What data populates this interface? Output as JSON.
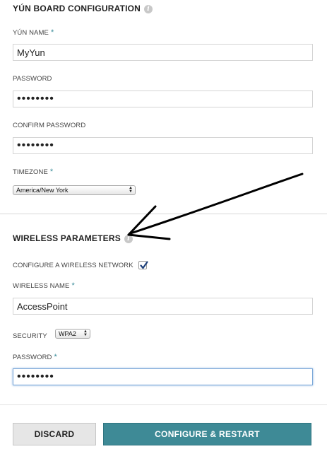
{
  "board_section": {
    "title": "YÚN BOARD CONFIGURATION",
    "info_glyph": "i",
    "name_label": "YÚN NAME",
    "name_value": "MyYun",
    "password_label": "PASSWORD",
    "password_value": "••••••••",
    "confirm_label": "CONFIRM PASSWORD",
    "confirm_value": "••••••••",
    "timezone_label": "TIMEZONE",
    "timezone_value": "America/New York"
  },
  "wireless_section": {
    "title": "WIRELESS PARAMETERS",
    "info_glyph": "i",
    "configure_label": "CONFIGURE A WIRELESS NETWORK",
    "configure_checked": true,
    "name_label": "WIRELESS NAME",
    "name_value": "AccessPoint",
    "security_label": "SECURITY",
    "security_value": "WPA2",
    "password_label": "PASSWORD",
    "password_value": "••••••••"
  },
  "required_marker": "*",
  "select_arrows": "▲▼",
  "actions": {
    "discard_label": "DISCARD",
    "configure_label": "CONFIGURE & RESTART"
  },
  "colors": {
    "accent": "#3e8a96",
    "required": "#3a8c9a"
  },
  "annotation": "hand-drawn black arrow pointing at the WIRELESS PARAMETERS info icon"
}
